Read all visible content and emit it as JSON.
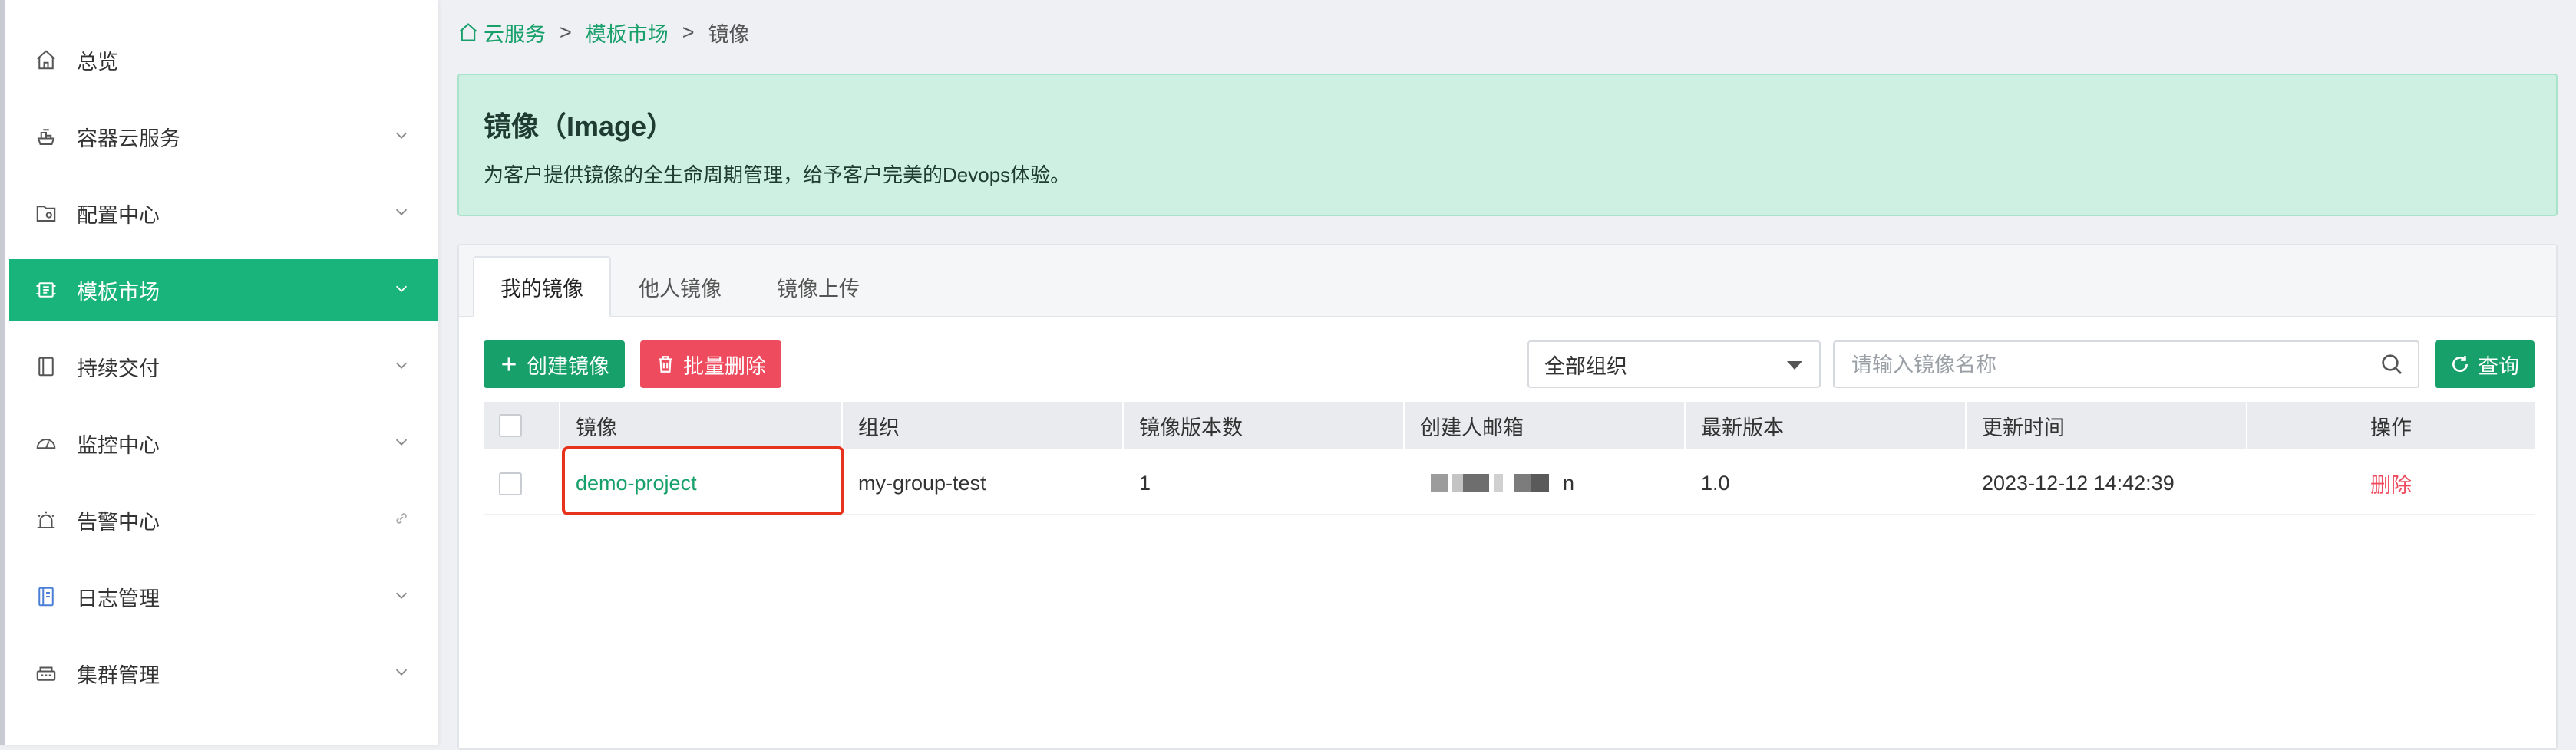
{
  "sidebar": {
    "items": [
      {
        "label": "总览",
        "icon": "home-icon"
      },
      {
        "label": "容器云服务",
        "icon": "container-cloud-icon"
      },
      {
        "label": "配置中心",
        "icon": "config-icon"
      },
      {
        "label": "模板市场",
        "icon": "template-market-icon",
        "active": true
      },
      {
        "label": "持续交付",
        "icon": "delivery-icon"
      },
      {
        "label": "监控中心",
        "icon": "monitor-icon"
      },
      {
        "label": "告警中心",
        "icon": "alarm-icon"
      },
      {
        "label": "日志管理",
        "icon": "log-icon"
      },
      {
        "label": "集群管理",
        "icon": "cluster-icon"
      }
    ]
  },
  "breadcrumb": {
    "items": [
      "云服务",
      "模板市场",
      "镜像"
    ],
    "separator": ">"
  },
  "banner": {
    "title": "镜像（Image）",
    "description": "为客户提供镜像的全生命周期管理，给予客户完美的Devops体验。"
  },
  "tabs": [
    "我的镜像",
    "他人镜像",
    "镜像上传"
  ],
  "toolbar": {
    "create_label": "创建镜像",
    "batch_delete_label": "批量删除",
    "org_select_value": "全部组织",
    "search_placeholder": "请输入镜像名称",
    "query_label": "查询"
  },
  "table": {
    "columns": [
      "镜像",
      "组织",
      "镜像版本数",
      "创建人邮箱",
      "最新版本",
      "更新时间",
      "操作"
    ],
    "rows": [
      {
        "image": "demo-project",
        "org": "my-group-test",
        "version_count": "1",
        "creator_email_suffix": "n",
        "latest_version": "1.0",
        "updated_at": "2023-12-12 14:42:39",
        "action": "删除"
      }
    ]
  },
  "colors": {
    "accent": "#18b47b",
    "danger": "#ef4b5e",
    "banner_bg": "#cdf0e2",
    "highlight": "#e8331c"
  }
}
